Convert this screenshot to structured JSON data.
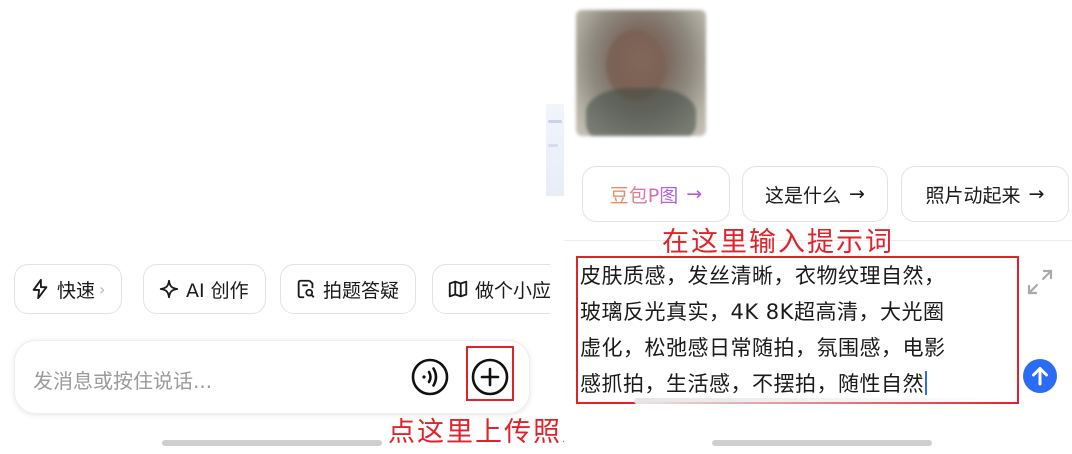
{
  "left": {
    "chips": [
      {
        "label": "快速",
        "icon": "lightning-icon",
        "chevron": "›"
      },
      {
        "label": "AI 创作",
        "icon": "sparkle-icon"
      },
      {
        "label": "拍题答疑",
        "icon": "scan-doc-icon"
      },
      {
        "label": "做个小应",
        "icon": "map-icon"
      }
    ],
    "input": {
      "placeholder": "发消息或按住说话..."
    },
    "annotation": "点这里上传照片"
  },
  "right": {
    "suggestions": [
      {
        "label": "豆包P图",
        "arrow": "→"
      },
      {
        "label": "这是什么",
        "arrow": "→"
      },
      {
        "label": "照片动起来",
        "arrow": "→"
      }
    ],
    "annotation": "在这里输入提示词",
    "prompt_lines": [
      "皮肤质感，发丝清晰，衣物纹理自然，",
      "玻璃反光真实，4K 8K超高清，大光圈",
      "虚化，松弛感日常随拍，氛围感，电影",
      "感抓拍，生活感，不摆拍，随性自然"
    ]
  },
  "colors": {
    "accent": "#2a6df4",
    "annotation_red": "#e0232a"
  }
}
